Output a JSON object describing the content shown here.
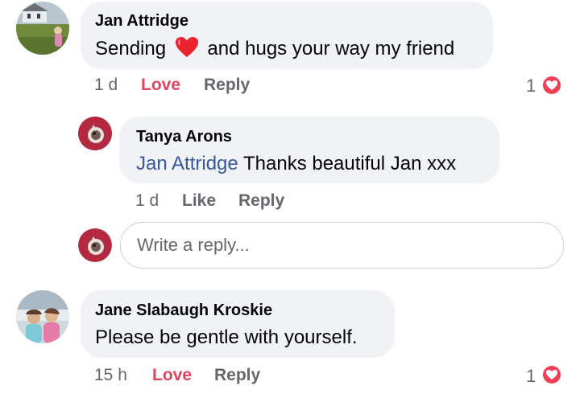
{
  "comments": [
    {
      "author": "Jan Attridge",
      "text_before": "Sending",
      "emoji": "red-heart-emoji",
      "text_after": "and hugs your way my friend",
      "time": "1 d",
      "reaction_label": "Love",
      "reply_label": "Reply",
      "reaction_count": "1",
      "reaction_icon": "heart-reaction-icon"
    },
    {
      "author": "Jane Slabaugh Kroskie",
      "text": "Please be gentle with yourself.",
      "time": "15 h",
      "reaction_label": "Love",
      "reply_label": "Reply",
      "reaction_count": "1",
      "reaction_icon": "heart-reaction-icon"
    }
  ],
  "reply": {
    "author": "Tanya Arons",
    "mention": "Jan Attridge",
    "text": "Thanks beautiful Jan xxx",
    "time": "1 d",
    "like_label": "Like",
    "reply_label": "Reply"
  },
  "write_reply": {
    "placeholder": "Write a reply..."
  },
  "colors": {
    "bubble": "#f0f2f5",
    "love": "#e0455f",
    "mention": "#385898",
    "heart_badge": "#f33e58"
  }
}
